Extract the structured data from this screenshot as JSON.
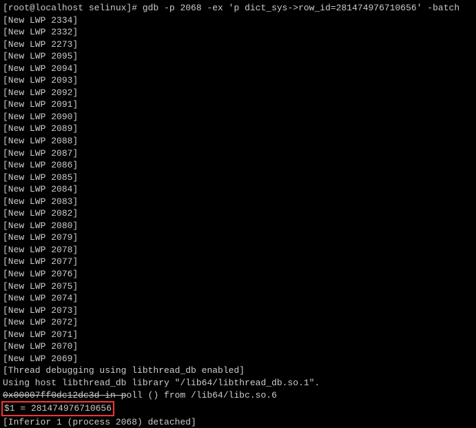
{
  "prompt": {
    "user_host": "[root@localhost selinux]# ",
    "command": "gdb -p 2068 -ex 'p dict_sys->row_id=281474976710656' -batch"
  },
  "lwp_lines": [
    "[New LWP 2334]",
    "[New LWP 2332]",
    "[New LWP 2273]",
    "[New LWP 2095]",
    "[New LWP 2094]",
    "[New LWP 2093]",
    "[New LWP 2092]",
    "[New LWP 2091]",
    "[New LWP 2090]",
    "[New LWP 2089]",
    "[New LWP 2088]",
    "[New LWP 2087]",
    "[New LWP 2086]",
    "[New LWP 2085]",
    "[New LWP 2084]",
    "[New LWP 2083]",
    "[New LWP 2082]",
    "[New LWP 2080]",
    "[New LWP 2079]",
    "[New LWP 2078]",
    "[New LWP 2077]",
    "[New LWP 2076]",
    "[New LWP 2075]",
    "[New LWP 2074]",
    "[New LWP 2073]",
    "[New LWP 2072]",
    "[New LWP 2071]",
    "[New LWP 2070]",
    "[New LWP 2069]"
  ],
  "thread_debug": "[Thread debugging using libthread_db enabled]",
  "host_lib": "Using host libthread_db library \"/lib64/libthread_db.so.1\".",
  "poll_line_strike": "0x00007ff0dc12dc3d in p",
  "poll_line_rest": "oll () from /lib64/libc.so.6",
  "result_line": "$1 = 281474976710656",
  "inferior_line": "[Inferior 1 (process 2068) detached]"
}
